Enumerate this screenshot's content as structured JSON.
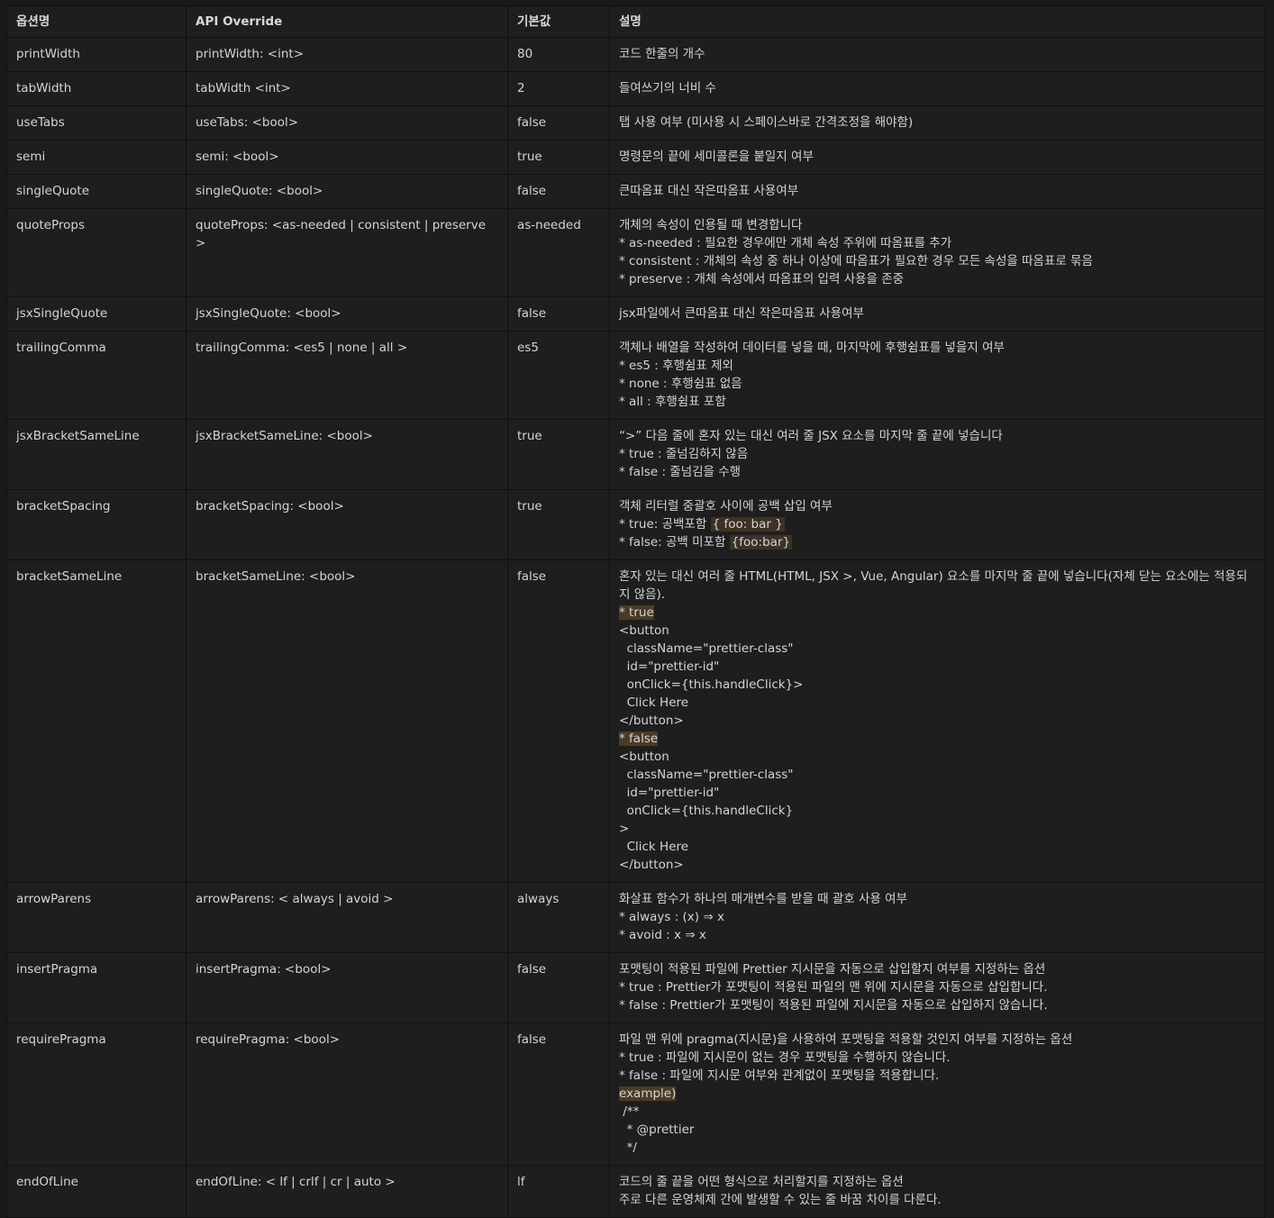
{
  "headers": [
    "옵션명",
    "API Override",
    "기본값",
    "설명"
  ],
  "rows": [
    {
      "name": "printWidth",
      "api": "printWidth: <int>",
      "def": "80",
      "desc": [
        {
          "t": "코드 한줄의 개수"
        }
      ]
    },
    {
      "name": "tabWidth",
      "api": "tabWidth <int>",
      "def": "2",
      "desc": [
        {
          "t": "들여쓰기의 너비 수"
        }
      ]
    },
    {
      "name": "useTabs",
      "api": "useTabs: <bool>",
      "def": "false",
      "desc": [
        {
          "t": "탭 사용 여부 (미사용 시 스페이스바로 간격조정을 해야함)"
        }
      ]
    },
    {
      "name": "semi",
      "api": "semi: <bool>",
      "def": "true",
      "desc": [
        {
          "t": "명령문의 끝에 세미콜론을 붙일지 여부"
        }
      ]
    },
    {
      "name": "singleQuote",
      "api": "singleQuote: <bool>",
      "def": "false",
      "desc": [
        {
          "t": "큰따옴표 대신 작은따옴표 사용여부"
        }
      ]
    },
    {
      "name": "quoteProps",
      "api": "quoteProps: <as-needed | consistent | preserve >",
      "def": "as-needed",
      "desc": [
        {
          "t": "개체의 속성이 인용될 때 변경합니다"
        },
        {
          "t": "* as-needed : 필요한 경우에만 개체 속성 주위에 따옴표를 추가"
        },
        {
          "t": "* consistent : 개체의 속성 중 하나 이상에 따옴표가 필요한 경우 모든 속성을 따옴표로 묶음"
        },
        {
          "t": "* preserve : 개체 속성에서 따옴표의 입력 사용을 존중"
        }
      ]
    },
    {
      "name": "jsxSingleQuote",
      "api": "jsxSingleQuote: <bool>",
      "def": "false",
      "desc": [
        {
          "t": "jsx파일에서 큰따옴표 대신 작은따옴표 사용여부"
        }
      ]
    },
    {
      "name": "trailingComma",
      "api": "trailingComma: <es5 | none | all >",
      "def": "es5",
      "desc": [
        {
          "t": "객체나 배열을 작성하여 데이터를 넣을 때, 마지막에 후행쉼표를 넣을지 여부"
        },
        {
          "t": "* es5 : 후행쉼표 제외"
        },
        {
          "t": "* none : 후행쉼표 없음"
        },
        {
          "t": "* all : 후행쉼표 포함"
        }
      ]
    },
    {
      "name": "jsxBracketSameLine",
      "api": "jsxBracketSameLine: <bool>",
      "def": "true",
      "desc": [
        {
          "t": "“>” 다음 줄에 혼자 있는 대신 여러 줄 JSX 요소를 마지막 줄 끝에 넣습니다"
        },
        {
          "t": "* true : 줄넘김하지 않음"
        },
        {
          "t": "* false : 줄넘김을 수행"
        }
      ]
    },
    {
      "name": "bracketSpacing",
      "api": "bracketSpacing: <bool>",
      "def": "true",
      "desc": [
        {
          "t": "객체 리터럴 중괄호 사이에 공백 삽입 여부"
        },
        {
          "t": "* true: 공백포함 ",
          "code": "{ foo: bar }"
        },
        {
          "t": "* false: 공백 미포함 ",
          "code": "{foo:bar}"
        }
      ]
    },
    {
      "name": "bracketSameLine",
      "api": "bracketSameLine: <bool>",
      "def": "false",
      "desc": [
        {
          "t": "혼자 있는 대신 여러 줄 HTML(HTML, JSX >, Vue, Angular) 요소를 마지막 줄 끝에 넣습니다(자체 닫는 요소에는 적용되지 않음).",
          "wrap": true
        },
        {
          "t": "* true",
          "hl": true
        },
        {
          "t": "<button"
        },
        {
          "t": "  className=\"prettier-class\""
        },
        {
          "t": "  id=\"prettier-id\""
        },
        {
          "t": "  onClick={this.handleClick}>"
        },
        {
          "t": "  Click Here"
        },
        {
          "t": "</button>"
        },
        {
          "t": "* false",
          "hl": true
        },
        {
          "t": "<button"
        },
        {
          "t": "  className=\"prettier-class\""
        },
        {
          "t": "  id=\"prettier-id\""
        },
        {
          "t": "  onClick={this.handleClick}"
        },
        {
          "t": ">"
        },
        {
          "t": "  Click Here"
        },
        {
          "t": "</button>"
        }
      ]
    },
    {
      "name": "arrowParens",
      "api": "arrowParens: < always | avoid >",
      "def": "always",
      "desc": [
        {
          "t": "화살표 함수가 하나의 매개변수를 받을 때 괄호 사용 여부"
        },
        {
          "t": "* always : (x) ⇒ x"
        },
        {
          "t": "* avoid : x ⇒ x"
        }
      ]
    },
    {
      "name": "insertPragma",
      "api": "insertPragma: <bool>",
      "def": "false",
      "desc": [
        {
          "t": "포맷팅이 적용된 파일에 Prettier 지시문을 자동으로 삽입할지 여부를 지정하는 옵션"
        },
        {
          "t": "* true : Prettier가 포맷팅이 적용된 파일의 맨 위에 지시문을 자동으로 삽입합니다."
        },
        {
          "t": "* false : Prettier가 포맷팅이 적용된 파일에 지시문을 자동으로 삽입하지 않습니다."
        }
      ]
    },
    {
      "name": "requirePragma",
      "api": "requirePragma: <bool>",
      "def": "false",
      "desc": [
        {
          "t": "파일 맨 위에 pragma(지시문)을 사용하여 포맷팅을 적용할 것인지 여부를 지정하는 옵션"
        },
        {
          "t": "* true : 파일에 지시문이 없는 경우 포맷팅을 수행하지 않습니다."
        },
        {
          "t": "* false : 파일에 지시문 여부와 관계없이 포맷팅을 적용합니다."
        },
        {
          "t": "example)",
          "hl": true
        },
        {
          "t": " /**"
        },
        {
          "t": "  * @prettier"
        },
        {
          "t": "  */"
        }
      ]
    },
    {
      "name": "endOfLine",
      "api": "endOfLine: < lf | crlf | cr | auto >",
      "def": "lf",
      "desc": [
        {
          "t": "코드의 줄 끝을 어떤 형식으로 처리할지를 지정하는 옵션"
        },
        {
          "t": "주로 다른 운영체제 간에 발생할 수 있는 줄 바꿈 차이를 다룬다."
        }
      ]
    }
  ]
}
